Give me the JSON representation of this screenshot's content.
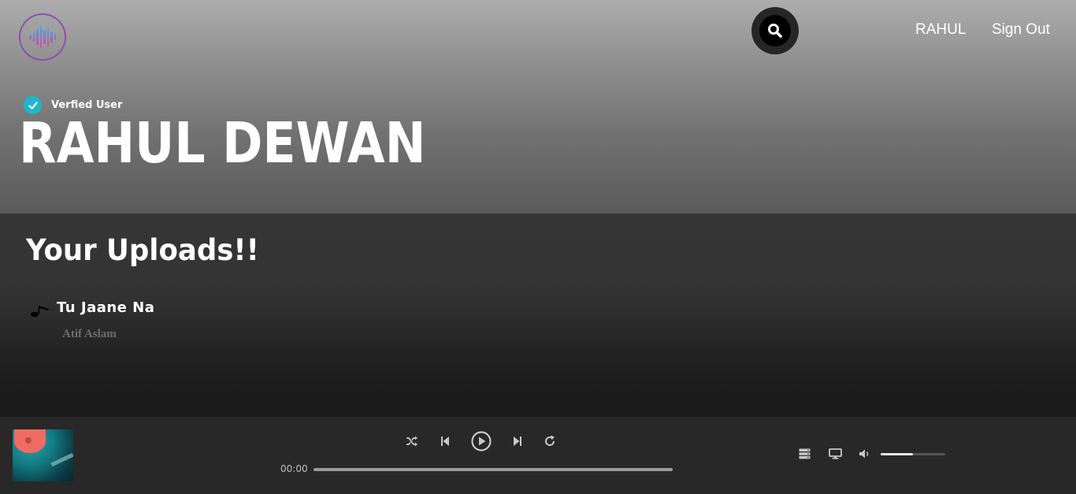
{
  "header": {
    "logo_icon": "soundwave-icon",
    "search_icon": "search-icon",
    "username": "RAHUL",
    "sign_out": "Sign Out"
  },
  "profile": {
    "verified_label": "Verfied User",
    "name": "RAHUL DEWAN"
  },
  "uploads": {
    "title": "Your Uploads!!",
    "songs": [
      {
        "icon": "music-note-icon",
        "title": "Tu Jaane Na",
        "artist": "Atif Aslam"
      }
    ]
  },
  "player": {
    "album_art": "album-art",
    "controls": [
      "shuffle-icon",
      "previous-icon",
      "play-icon",
      "next-icon",
      "repeat-icon"
    ],
    "current_time": "00:00",
    "progress": 0,
    "right_icons": [
      "queue-icon",
      "device-icon",
      "volume-icon"
    ],
    "volume": 0.5
  },
  "colors": {
    "accent": "#1fb6ce",
    "player_bg": "#282828",
    "logo_gradient_start": "#4ea2e0",
    "logo_gradient_end": "#c84fa6"
  }
}
